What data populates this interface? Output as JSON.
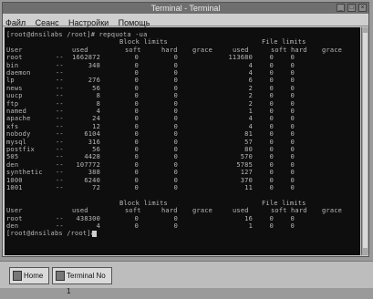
{
  "window": {
    "title": "Terminal - Terminal",
    "controls": [
      "minimize-icon",
      "maximize-icon",
      "close-icon"
    ]
  },
  "menu": [
    "Файл",
    "Сеанс",
    "Настройки",
    "Помощь"
  ],
  "terminal": {
    "prompt_cmd": "[root@dnsilabs /root]# repquota -ua",
    "group_header": {
      "block": "Block limits",
      "file": "File limits"
    },
    "columns": [
      "User",
      "used",
      "soft",
      "hard",
      "grace",
      "used",
      "soft",
      "hard",
      "grace"
    ],
    "rows1": [
      [
        "root",
        "--",
        "1662872",
        "0",
        "0",
        "",
        "113680",
        "0",
        "0"
      ],
      [
        "bin",
        "--",
        "348",
        "0",
        "0",
        "",
        "4",
        "0",
        "0"
      ],
      [
        "daemon",
        "--",
        "",
        "0",
        "0",
        "",
        "4",
        "0",
        "0"
      ],
      [
        "lp",
        "--",
        "276",
        "0",
        "0",
        "",
        "6",
        "0",
        "0"
      ],
      [
        "news",
        "--",
        "56",
        "0",
        "0",
        "",
        "2",
        "0",
        "0"
      ],
      [
        "uucp",
        "--",
        "8",
        "0",
        "0",
        "",
        "2",
        "0",
        "0"
      ],
      [
        "ftp",
        "--",
        "8",
        "0",
        "0",
        "",
        "2",
        "0",
        "0"
      ],
      [
        "named",
        "--",
        "4",
        "0",
        "0",
        "",
        "1",
        "0",
        "0"
      ],
      [
        "apache",
        "--",
        "24",
        "0",
        "0",
        "",
        "4",
        "0",
        "0"
      ],
      [
        "xfs",
        "--",
        "12",
        "0",
        "0",
        "",
        "4",
        "0",
        "0"
      ],
      [
        "nobody",
        "--",
        "6104",
        "0",
        "0",
        "",
        "81",
        "0",
        "0"
      ],
      [
        "mysql",
        "--",
        "316",
        "0",
        "0",
        "",
        "57",
        "0",
        "0"
      ],
      [
        "postfix",
        "--",
        "56",
        "0",
        "0",
        "",
        "80",
        "0",
        "0"
      ],
      [
        "505",
        "--",
        "4428",
        "0",
        "0",
        "",
        "570",
        "0",
        "0"
      ],
      [
        "den",
        "--",
        "107772",
        "0",
        "0",
        "",
        "5785",
        "0",
        "0"
      ],
      [
        "synthetic",
        "--",
        "388",
        "0",
        "0",
        "",
        "127",
        "0",
        "0"
      ],
      [
        "1000",
        "--",
        "6240",
        "0",
        "0",
        "",
        "370",
        "0",
        "0"
      ],
      [
        "1001",
        "--",
        "72",
        "0",
        "0",
        "",
        "11",
        "0",
        "0"
      ]
    ],
    "rows2": [
      [
        "root",
        "--",
        "438300",
        "0",
        "0",
        "",
        "16",
        "0",
        "0"
      ],
      [
        "den",
        "--",
        "4",
        "0",
        "0",
        "",
        "1",
        "0",
        "0"
      ]
    ],
    "final_prompt": "[root@dnsilabs /root]#"
  },
  "taskbar": {
    "items": [
      {
        "label": "Home",
        "icon": "home-folder-icon"
      },
      {
        "label": "Terminal No 1",
        "icon": "terminal-icon"
      }
    ]
  }
}
